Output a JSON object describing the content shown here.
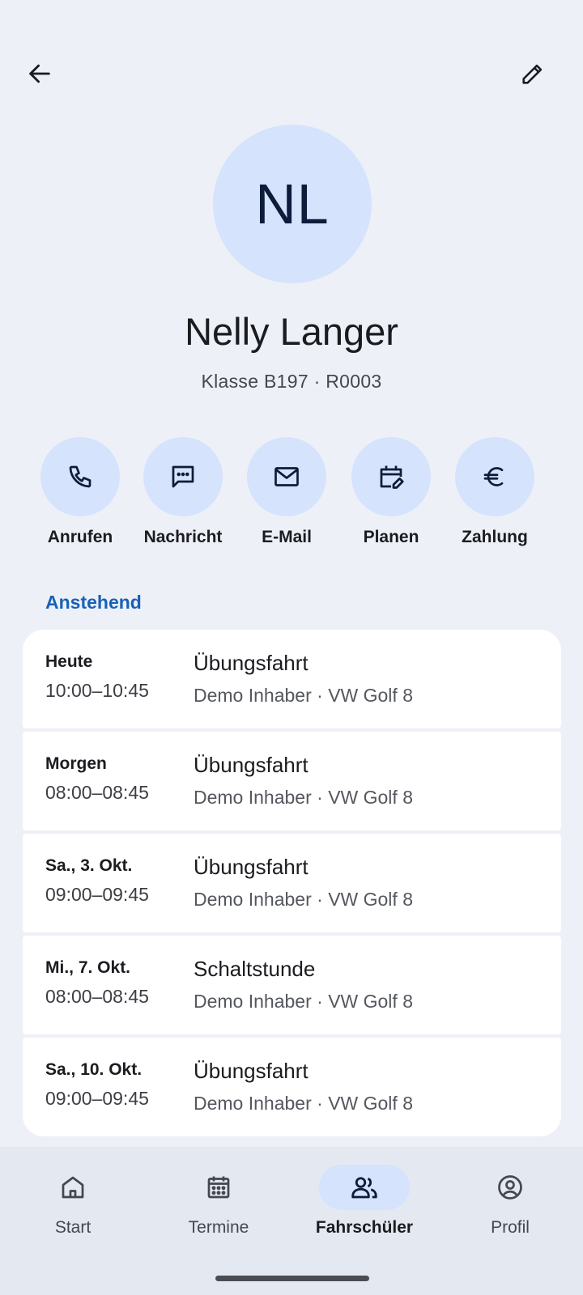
{
  "header": {
    "back_icon": "arrow-left-icon",
    "edit_icon": "pencil-icon"
  },
  "profile": {
    "initials": "NL",
    "name": "Nelly Langer",
    "subtitle": "Klasse B197 · R0003"
  },
  "actions": [
    {
      "label": "Anrufen",
      "icon": "phone-icon"
    },
    {
      "label": "Nachricht",
      "icon": "message-icon"
    },
    {
      "label": "E-Mail",
      "icon": "mail-icon"
    },
    {
      "label": "Planen",
      "icon": "calendar-edit-icon"
    },
    {
      "label": "Zahlung",
      "icon": "euro-icon"
    }
  ],
  "upcoming": {
    "title": "Anstehend",
    "items": [
      {
        "day": "Heute",
        "time": "10:00–10:45",
        "type": "Übungsfahrt",
        "meta": "Demo Inhaber · VW Golf 8"
      },
      {
        "day": "Morgen",
        "time": "08:00–08:45",
        "type": "Übungsfahrt",
        "meta": "Demo Inhaber · VW Golf 8"
      },
      {
        "day": "Sa., 3. Okt.",
        "time": "09:00–09:45",
        "type": "Übungsfahrt",
        "meta": "Demo Inhaber · VW Golf 8"
      },
      {
        "day": "Mi., 7. Okt.",
        "time": "08:00–08:45",
        "type": "Schaltstunde",
        "meta": "Demo Inhaber · VW Golf 8"
      },
      {
        "day": "Sa., 10. Okt.",
        "time": "09:00–09:45",
        "type": "Übungsfahrt",
        "meta": "Demo Inhaber · VW Golf 8"
      }
    ]
  },
  "nav": {
    "active": "Fahrschüler",
    "items": [
      {
        "label": "Start",
        "icon": "home-icon"
      },
      {
        "label": "Termine",
        "icon": "calendar-icon"
      },
      {
        "label": "Fahrschüler",
        "icon": "people-icon"
      },
      {
        "label": "Profil",
        "icon": "account-circle-icon"
      }
    ]
  },
  "colors": {
    "background": "#eef0f8",
    "accent_container": "#d5e3fc",
    "accent_text": "#1861b5",
    "card": "#ffffff"
  }
}
